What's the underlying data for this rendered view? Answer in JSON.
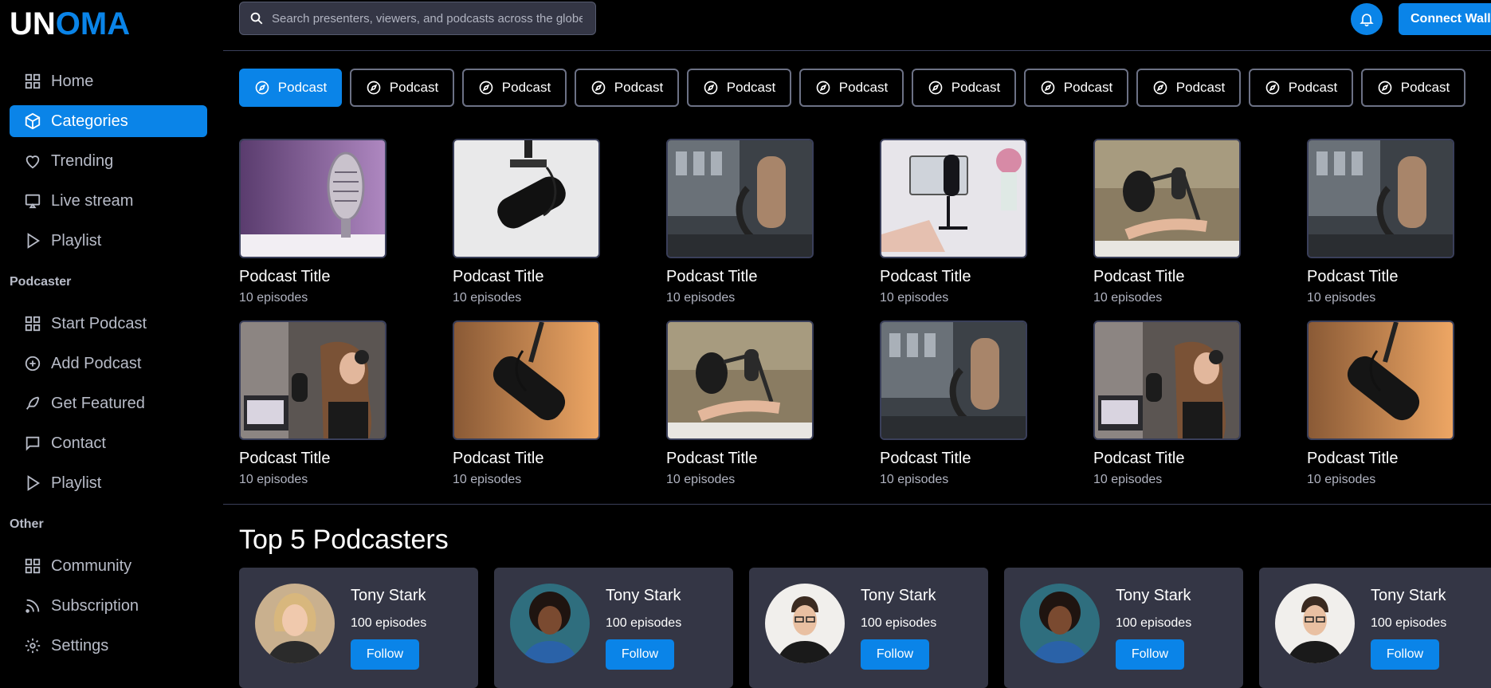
{
  "brand": {
    "part1": "UN",
    "part2": "OMA"
  },
  "sidebar": {
    "main": [
      {
        "label": "Home",
        "icon": "grid-icon"
      },
      {
        "label": "Categories",
        "icon": "cube-icon",
        "active": true
      },
      {
        "label": "Trending",
        "icon": "heart-icon"
      },
      {
        "label": "Live stream",
        "icon": "cast-icon"
      },
      {
        "label": "Playlist",
        "icon": "play-icon"
      }
    ],
    "podcaster_label": "Podcaster",
    "podcaster": [
      {
        "label": "Start Podcast",
        "icon": "grid-icon"
      },
      {
        "label": "Add Podcast",
        "icon": "plus-circle-icon"
      },
      {
        "label": "Get Featured",
        "icon": "feather-icon"
      },
      {
        "label": "Contact",
        "icon": "message-icon"
      },
      {
        "label": "Playlist",
        "icon": "play-icon"
      }
    ],
    "other_label": "Other",
    "other": [
      {
        "label": "Community",
        "icon": "grid-icon"
      },
      {
        "label": "Subscription",
        "icon": "rss-icon"
      },
      {
        "label": "Settings",
        "icon": "gear-icon"
      }
    ]
  },
  "topbar": {
    "search_placeholder": "Search presenters, viewers, and podcasts across the globe",
    "connect_label": "Connect Wallet"
  },
  "chips": [
    "Podcast",
    "Podcast",
    "Podcast",
    "Podcast",
    "Podcast",
    "Podcast",
    "Podcast",
    "Podcast",
    "Podcast",
    "Podcast",
    "Podcast"
  ],
  "podcasts": [
    {
      "title": "Podcast Title",
      "episodes": "10 episodes"
    },
    {
      "title": "Podcast Title",
      "episodes": "10 episodes"
    },
    {
      "title": "Podcast Title",
      "episodes": "10 episodes"
    },
    {
      "title": "Podcast Title",
      "episodes": "10 episodes"
    },
    {
      "title": "Podcast Title",
      "episodes": "10 episodes"
    },
    {
      "title": "Podcast Title",
      "episodes": "10 episodes"
    },
    {
      "title": "Podcast Title",
      "episodes": "10 episodes"
    },
    {
      "title": "Podcast Title",
      "episodes": "10 episodes"
    },
    {
      "title": "Podcast Title",
      "episodes": "10 episodes"
    },
    {
      "title": "Podcast Title",
      "episodes": "10 episodes"
    },
    {
      "title": "Podcast Title",
      "episodes": "10 episodes"
    },
    {
      "title": "Podcast Title",
      "episodes": "10 episodes"
    }
  ],
  "top_section": {
    "title": "Top 5 Podcasters"
  },
  "podcasters": [
    {
      "name": "Tony Stark",
      "episodes": "100 episodes",
      "follow": "Follow"
    },
    {
      "name": "Tony Stark",
      "episodes": "100 episodes",
      "follow": "Follow"
    },
    {
      "name": "Tony Stark",
      "episodes": "100 episodes",
      "follow": "Follow"
    },
    {
      "name": "Tony Stark",
      "episodes": "100 episodes",
      "follow": "Follow"
    },
    {
      "name": "Tony Stark",
      "episodes": "100 episodes",
      "follow": "Follow"
    }
  ],
  "colors": {
    "accent": "#0a84e8",
    "card": "#343645",
    "border": "#3a3f5a"
  }
}
